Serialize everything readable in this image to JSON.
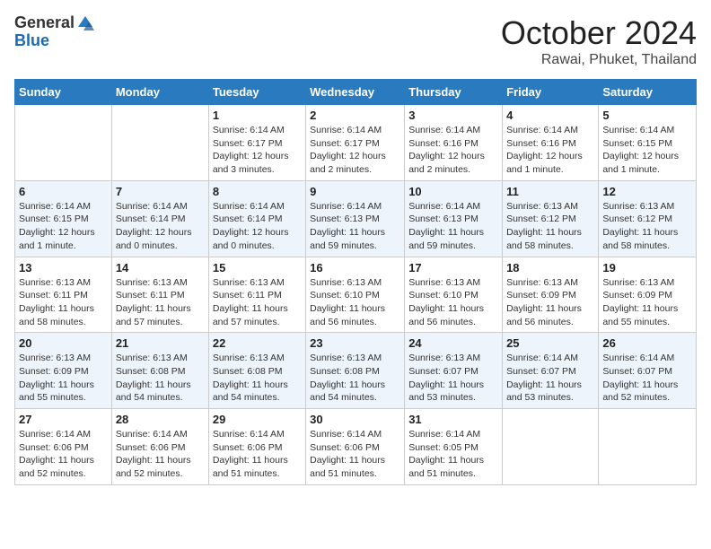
{
  "header": {
    "logo_general": "General",
    "logo_blue": "Blue",
    "month": "October 2024",
    "location": "Rawai, Phuket, Thailand"
  },
  "days_of_week": [
    "Sunday",
    "Monday",
    "Tuesday",
    "Wednesday",
    "Thursday",
    "Friday",
    "Saturday"
  ],
  "weeks": [
    [
      {
        "day": "",
        "info": ""
      },
      {
        "day": "",
        "info": ""
      },
      {
        "day": "1",
        "info": "Sunrise: 6:14 AM\nSunset: 6:17 PM\nDaylight: 12 hours and 3 minutes."
      },
      {
        "day": "2",
        "info": "Sunrise: 6:14 AM\nSunset: 6:17 PM\nDaylight: 12 hours and 2 minutes."
      },
      {
        "day": "3",
        "info": "Sunrise: 6:14 AM\nSunset: 6:16 PM\nDaylight: 12 hours and 2 minutes."
      },
      {
        "day": "4",
        "info": "Sunrise: 6:14 AM\nSunset: 6:16 PM\nDaylight: 12 hours and 1 minute."
      },
      {
        "day": "5",
        "info": "Sunrise: 6:14 AM\nSunset: 6:15 PM\nDaylight: 12 hours and 1 minute."
      }
    ],
    [
      {
        "day": "6",
        "info": "Sunrise: 6:14 AM\nSunset: 6:15 PM\nDaylight: 12 hours and 1 minute."
      },
      {
        "day": "7",
        "info": "Sunrise: 6:14 AM\nSunset: 6:14 PM\nDaylight: 12 hours and 0 minutes."
      },
      {
        "day": "8",
        "info": "Sunrise: 6:14 AM\nSunset: 6:14 PM\nDaylight: 12 hours and 0 minutes."
      },
      {
        "day": "9",
        "info": "Sunrise: 6:14 AM\nSunset: 6:13 PM\nDaylight: 11 hours and 59 minutes."
      },
      {
        "day": "10",
        "info": "Sunrise: 6:14 AM\nSunset: 6:13 PM\nDaylight: 11 hours and 59 minutes."
      },
      {
        "day": "11",
        "info": "Sunrise: 6:13 AM\nSunset: 6:12 PM\nDaylight: 11 hours and 58 minutes."
      },
      {
        "day": "12",
        "info": "Sunrise: 6:13 AM\nSunset: 6:12 PM\nDaylight: 11 hours and 58 minutes."
      }
    ],
    [
      {
        "day": "13",
        "info": "Sunrise: 6:13 AM\nSunset: 6:11 PM\nDaylight: 11 hours and 58 minutes."
      },
      {
        "day": "14",
        "info": "Sunrise: 6:13 AM\nSunset: 6:11 PM\nDaylight: 11 hours and 57 minutes."
      },
      {
        "day": "15",
        "info": "Sunrise: 6:13 AM\nSunset: 6:11 PM\nDaylight: 11 hours and 57 minutes."
      },
      {
        "day": "16",
        "info": "Sunrise: 6:13 AM\nSunset: 6:10 PM\nDaylight: 11 hours and 56 minutes."
      },
      {
        "day": "17",
        "info": "Sunrise: 6:13 AM\nSunset: 6:10 PM\nDaylight: 11 hours and 56 minutes."
      },
      {
        "day": "18",
        "info": "Sunrise: 6:13 AM\nSunset: 6:09 PM\nDaylight: 11 hours and 56 minutes."
      },
      {
        "day": "19",
        "info": "Sunrise: 6:13 AM\nSunset: 6:09 PM\nDaylight: 11 hours and 55 minutes."
      }
    ],
    [
      {
        "day": "20",
        "info": "Sunrise: 6:13 AM\nSunset: 6:09 PM\nDaylight: 11 hours and 55 minutes."
      },
      {
        "day": "21",
        "info": "Sunrise: 6:13 AM\nSunset: 6:08 PM\nDaylight: 11 hours and 54 minutes."
      },
      {
        "day": "22",
        "info": "Sunrise: 6:13 AM\nSunset: 6:08 PM\nDaylight: 11 hours and 54 minutes."
      },
      {
        "day": "23",
        "info": "Sunrise: 6:13 AM\nSunset: 6:08 PM\nDaylight: 11 hours and 54 minutes."
      },
      {
        "day": "24",
        "info": "Sunrise: 6:13 AM\nSunset: 6:07 PM\nDaylight: 11 hours and 53 minutes."
      },
      {
        "day": "25",
        "info": "Sunrise: 6:14 AM\nSunset: 6:07 PM\nDaylight: 11 hours and 53 minutes."
      },
      {
        "day": "26",
        "info": "Sunrise: 6:14 AM\nSunset: 6:07 PM\nDaylight: 11 hours and 52 minutes."
      }
    ],
    [
      {
        "day": "27",
        "info": "Sunrise: 6:14 AM\nSunset: 6:06 PM\nDaylight: 11 hours and 52 minutes."
      },
      {
        "day": "28",
        "info": "Sunrise: 6:14 AM\nSunset: 6:06 PM\nDaylight: 11 hours and 52 minutes."
      },
      {
        "day": "29",
        "info": "Sunrise: 6:14 AM\nSunset: 6:06 PM\nDaylight: 11 hours and 51 minutes."
      },
      {
        "day": "30",
        "info": "Sunrise: 6:14 AM\nSunset: 6:06 PM\nDaylight: 11 hours and 51 minutes."
      },
      {
        "day": "31",
        "info": "Sunrise: 6:14 AM\nSunset: 6:05 PM\nDaylight: 11 hours and 51 minutes."
      },
      {
        "day": "",
        "info": ""
      },
      {
        "day": "",
        "info": ""
      }
    ]
  ]
}
